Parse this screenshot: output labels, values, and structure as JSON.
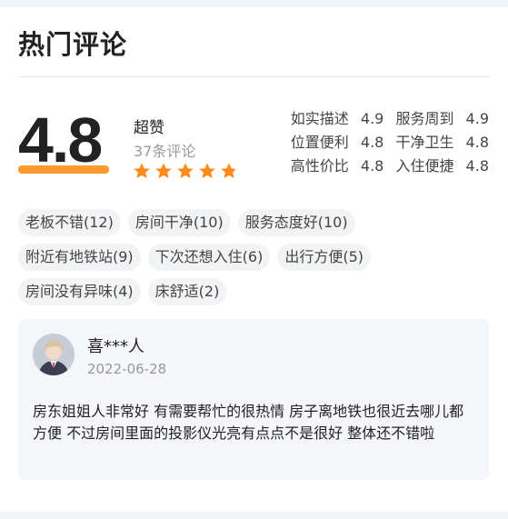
{
  "section": {
    "title": "热门评论"
  },
  "summary": {
    "score": "4.8",
    "rating_label": "超赞",
    "review_count": "37条评论",
    "stars": {
      "value": 4.8,
      "max": 5,
      "color": "#ff8a1e"
    }
  },
  "metrics": [
    [
      {
        "label": "如实描述",
        "value": "4.9"
      },
      {
        "label": "服务周到",
        "value": "4.9"
      }
    ],
    [
      {
        "label": "位置便利",
        "value": "4.8"
      },
      {
        "label": "干净卫生",
        "value": "4.8"
      }
    ],
    [
      {
        "label": "高性价比",
        "value": "4.8"
      },
      {
        "label": "入住便捷",
        "value": "4.8"
      }
    ]
  ],
  "tags": [
    [
      "老板不错(12)",
      "房间干净(10)",
      "服务态度好(10)"
    ],
    [
      "附近有地铁站(9)",
      "下次还想入住(6)",
      "出行方便(5)"
    ],
    [
      "房间没有异味(4)",
      "床舒适(2)"
    ]
  ],
  "review": {
    "avatar_icon": "user-avatar",
    "name": "喜***人",
    "date": "2022-06-28",
    "text": "房东姐姐人非常好 有需要帮忙的很热情 房子离地铁也很近去哪儿都方便 不过房间里面的投影仪光亮有点点不是很好 整体还不错啦"
  },
  "colors": {
    "accent": "#ff8a1e",
    "underline": "#ff9a2e",
    "tag_bg": "#f2f3f5",
    "card_bg": "#f5f6f9"
  }
}
